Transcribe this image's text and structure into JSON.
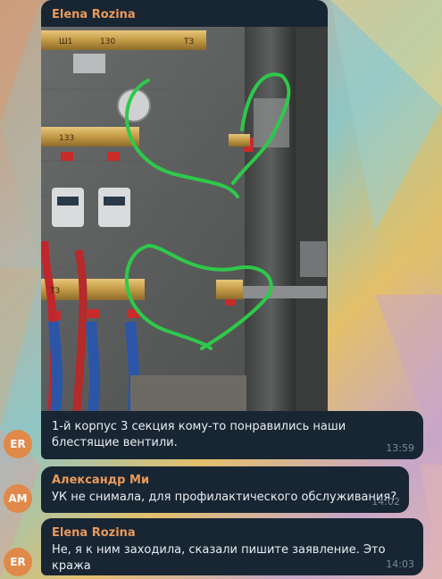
{
  "messages": [
    {
      "sender": "Elena Rozina",
      "sender_color": "#e99a5a",
      "text": "1-й корпус 3 секция кому-то понравились наши блестящие вентили.",
      "time": "13:59",
      "avatar": "ER",
      "has_photo": true
    },
    {
      "sender": "Александр Ми",
      "sender_color": "#e99a5a",
      "text": "УК не снимала, для профилактического обслуживания?",
      "time": "14:02",
      "avatar": "AM"
    },
    {
      "sender": "Elena Rozina",
      "sender_color": "#e99a5a",
      "text": "Не, я к ним заходила, сказали пишите заявление. Это кража",
      "time": "14:03",
      "avatar": "ER"
    }
  ],
  "photo": {
    "pipe_labels": [
      "Ш1",
      "130",
      "Т3",
      "133",
      "Т3"
    ]
  },
  "colors": {
    "bubble": "#182533",
    "accent": "#e99a5a",
    "annotation": "#2ec94a"
  }
}
